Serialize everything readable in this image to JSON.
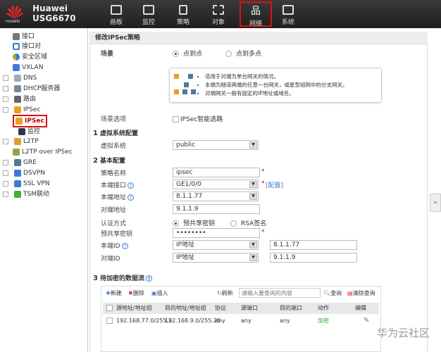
{
  "header": {
    "logo_text": "HUAWEI",
    "brand": "Huawei",
    "model": "USG6670",
    "nav": [
      {
        "label": "画板"
      },
      {
        "label": "监控"
      },
      {
        "label": "策略"
      },
      {
        "label": "对象"
      },
      {
        "label": "网络",
        "active": true
      },
      {
        "label": "系统"
      }
    ]
  },
  "sidebar": {
    "items": [
      {
        "label": "接口"
      },
      {
        "label": "接口对"
      },
      {
        "label": "安全区域"
      },
      {
        "label": "VXLAN"
      },
      {
        "label": "DNS"
      },
      {
        "label": "DHCP服务器"
      },
      {
        "label": "路由"
      },
      {
        "label": "IPSec"
      },
      {
        "label": "IPSec"
      },
      {
        "label": "监控"
      },
      {
        "label": "L2TP"
      },
      {
        "label": "L2TP over IPSec"
      },
      {
        "label": "GRE"
      },
      {
        "label": "DSVPN"
      },
      {
        "label": "SSL VPN"
      },
      {
        "label": "TSM联动"
      }
    ]
  },
  "panel": {
    "title": "修改IPSec策略",
    "scene": {
      "label": "场景",
      "opt1": "点到点",
      "opt2": "点到多点",
      "tips": [
        "适用于对端为单台网关的情况。",
        "本端为隧道两端的任意一台网关，或星型组网中的分支网关。",
        "对端网关一般有固定的IP地址或域名。"
      ]
    },
    "scene_opt": {
      "label": "场景选项",
      "checkbox": "IPSec智能选路"
    },
    "sec1": {
      "num": "1",
      "title": "虚拟系统配置",
      "vsys_label": "虚拟系统",
      "vsys_value": "public"
    },
    "sec2": {
      "num": "2",
      "title": "基本配置",
      "policy_name_label": "策略名称",
      "policy_name": "ipsec",
      "local_if_label": "本端接口",
      "local_if": "GE1/0/0",
      "config_link": "[配置]",
      "local_addr_label": "本端地址",
      "local_addr": "8.1.1.77",
      "peer_addr_label": "对端地址",
      "peer_addr": "9.1.1.9",
      "auth_label": "认证方式",
      "auth_opt1": "预共享密钥",
      "auth_opt2": "RSA签名",
      "psk_label": "预共享密钥",
      "psk": "••••••••",
      "local_id_label": "本端ID",
      "local_id_type": "IP地址",
      "local_id": "8.1.1.77",
      "peer_id_label": "对端ID",
      "peer_id_type": "IP地址",
      "peer_id": "9.1.1.9"
    },
    "sec3": {
      "num": "3",
      "title": "待加密的数据流",
      "toolbar": {
        "new": "新建",
        "delete": "删除",
        "insert": "插入",
        "refresh": "刷新",
        "search_placeholder": "请输入要查询的内容",
        "query": "查询",
        "clear": "清除查询"
      },
      "columns": [
        "源地址/地址组",
        "目的地址/地址组",
        "协议",
        "源端口",
        "目的端口",
        "动作",
        "编辑"
      ],
      "rows": [
        {
          "src": "192.168.77.0/255.2",
          "dst": "192.168.9.0/255.25",
          "proto": "any",
          "sport": "any",
          "dport": "any",
          "action": "加密"
        }
      ]
    }
  },
  "watermark": "华为云社区"
}
